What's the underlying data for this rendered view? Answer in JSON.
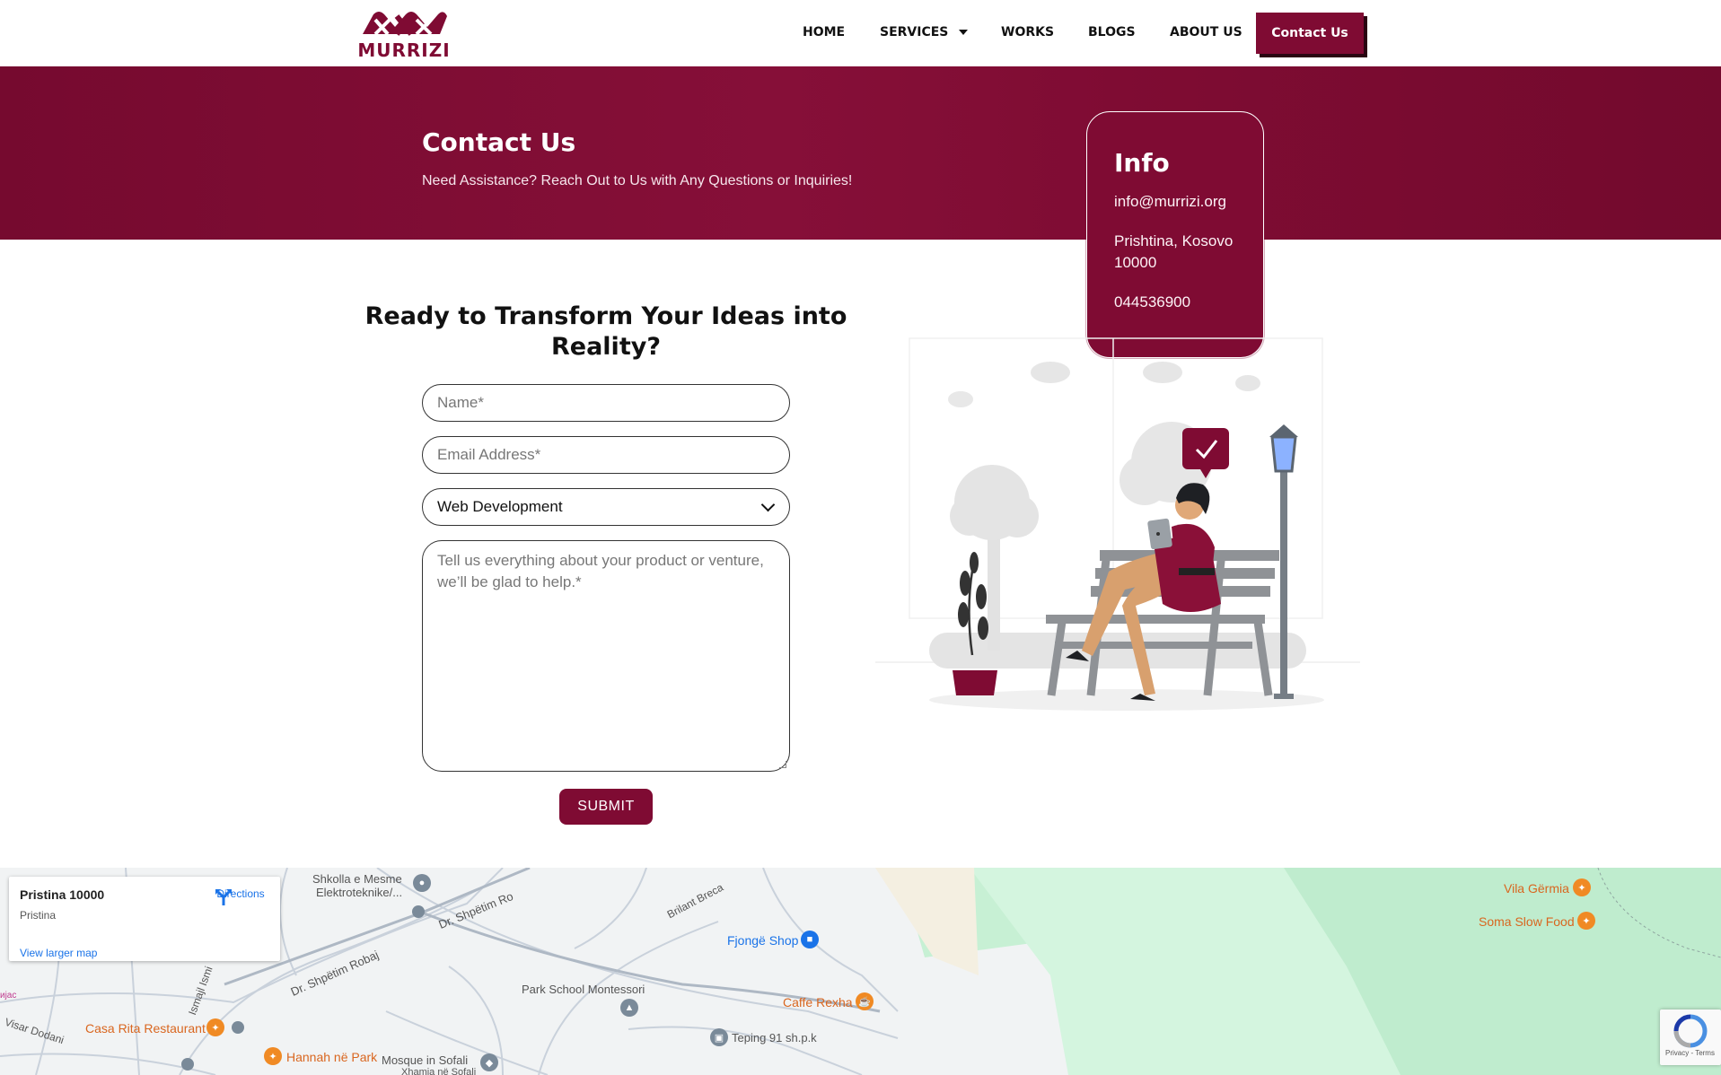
{
  "brand": {
    "name": "MURRIZI",
    "color": "#7f0b33"
  },
  "nav": {
    "items": [
      "HOME",
      "SERVICES",
      "WORKS",
      "BLOGS",
      "ABOUT US"
    ],
    "cta": "Contact Us"
  },
  "hero": {
    "title": "Contact Us",
    "subtitle": "Need Assistance? Reach Out to Us with Any Questions or Inquiries!"
  },
  "info": {
    "title": "Info",
    "email": "info@murrizi.org",
    "address_line1": "Prishtina, Kosovo",
    "address_line2": "10000",
    "phone": "044536900"
  },
  "form": {
    "heading_line1": "Ready to Transform Your Ideas into",
    "heading_line2": "Reality?",
    "name_placeholder": "Name*",
    "email_placeholder": "Email Address*",
    "service_selected": "Web Development",
    "message_placeholder": "Tell us everything about your product or venture, we’ll be glad to help.*",
    "submit": "SUBMIT"
  },
  "map": {
    "card_title": "Pristina 10000",
    "card_subtitle": "Pristina",
    "directions": "Directions",
    "larger_map": "View larger map",
    "labels": {
      "school_line1": "Shkolla e Mesme",
      "school_line2": "Elektroteknike/...",
      "street_shpetim_robaj": "Dr. Shpëtim Robaj",
      "street_shpetim_ro": "Dr. Shpëtim Ro",
      "street_brilant": "Brilant Breca",
      "street_ismajl": "Ismajl Ismi",
      "street_visar": "Visar Dodani",
      "fjonge": "Fjongë Shop",
      "park_school": "Park School Montessori",
      "caffe": "Caffe Rexha",
      "teping": "Teping 91 sh.p.k",
      "casa_rita": "Casa Rita Restaurant",
      "hannah": "Hannah në Park",
      "mosque_line1": "Mosque in Sofali",
      "mosque_line2": "Xhamia në Sofali",
      "vila_germia": "Vila Gërmia",
      "soma": "Soma Slow Food",
      "edge": "ијас"
    },
    "recaptcha_text": "Privacy - Terms"
  }
}
